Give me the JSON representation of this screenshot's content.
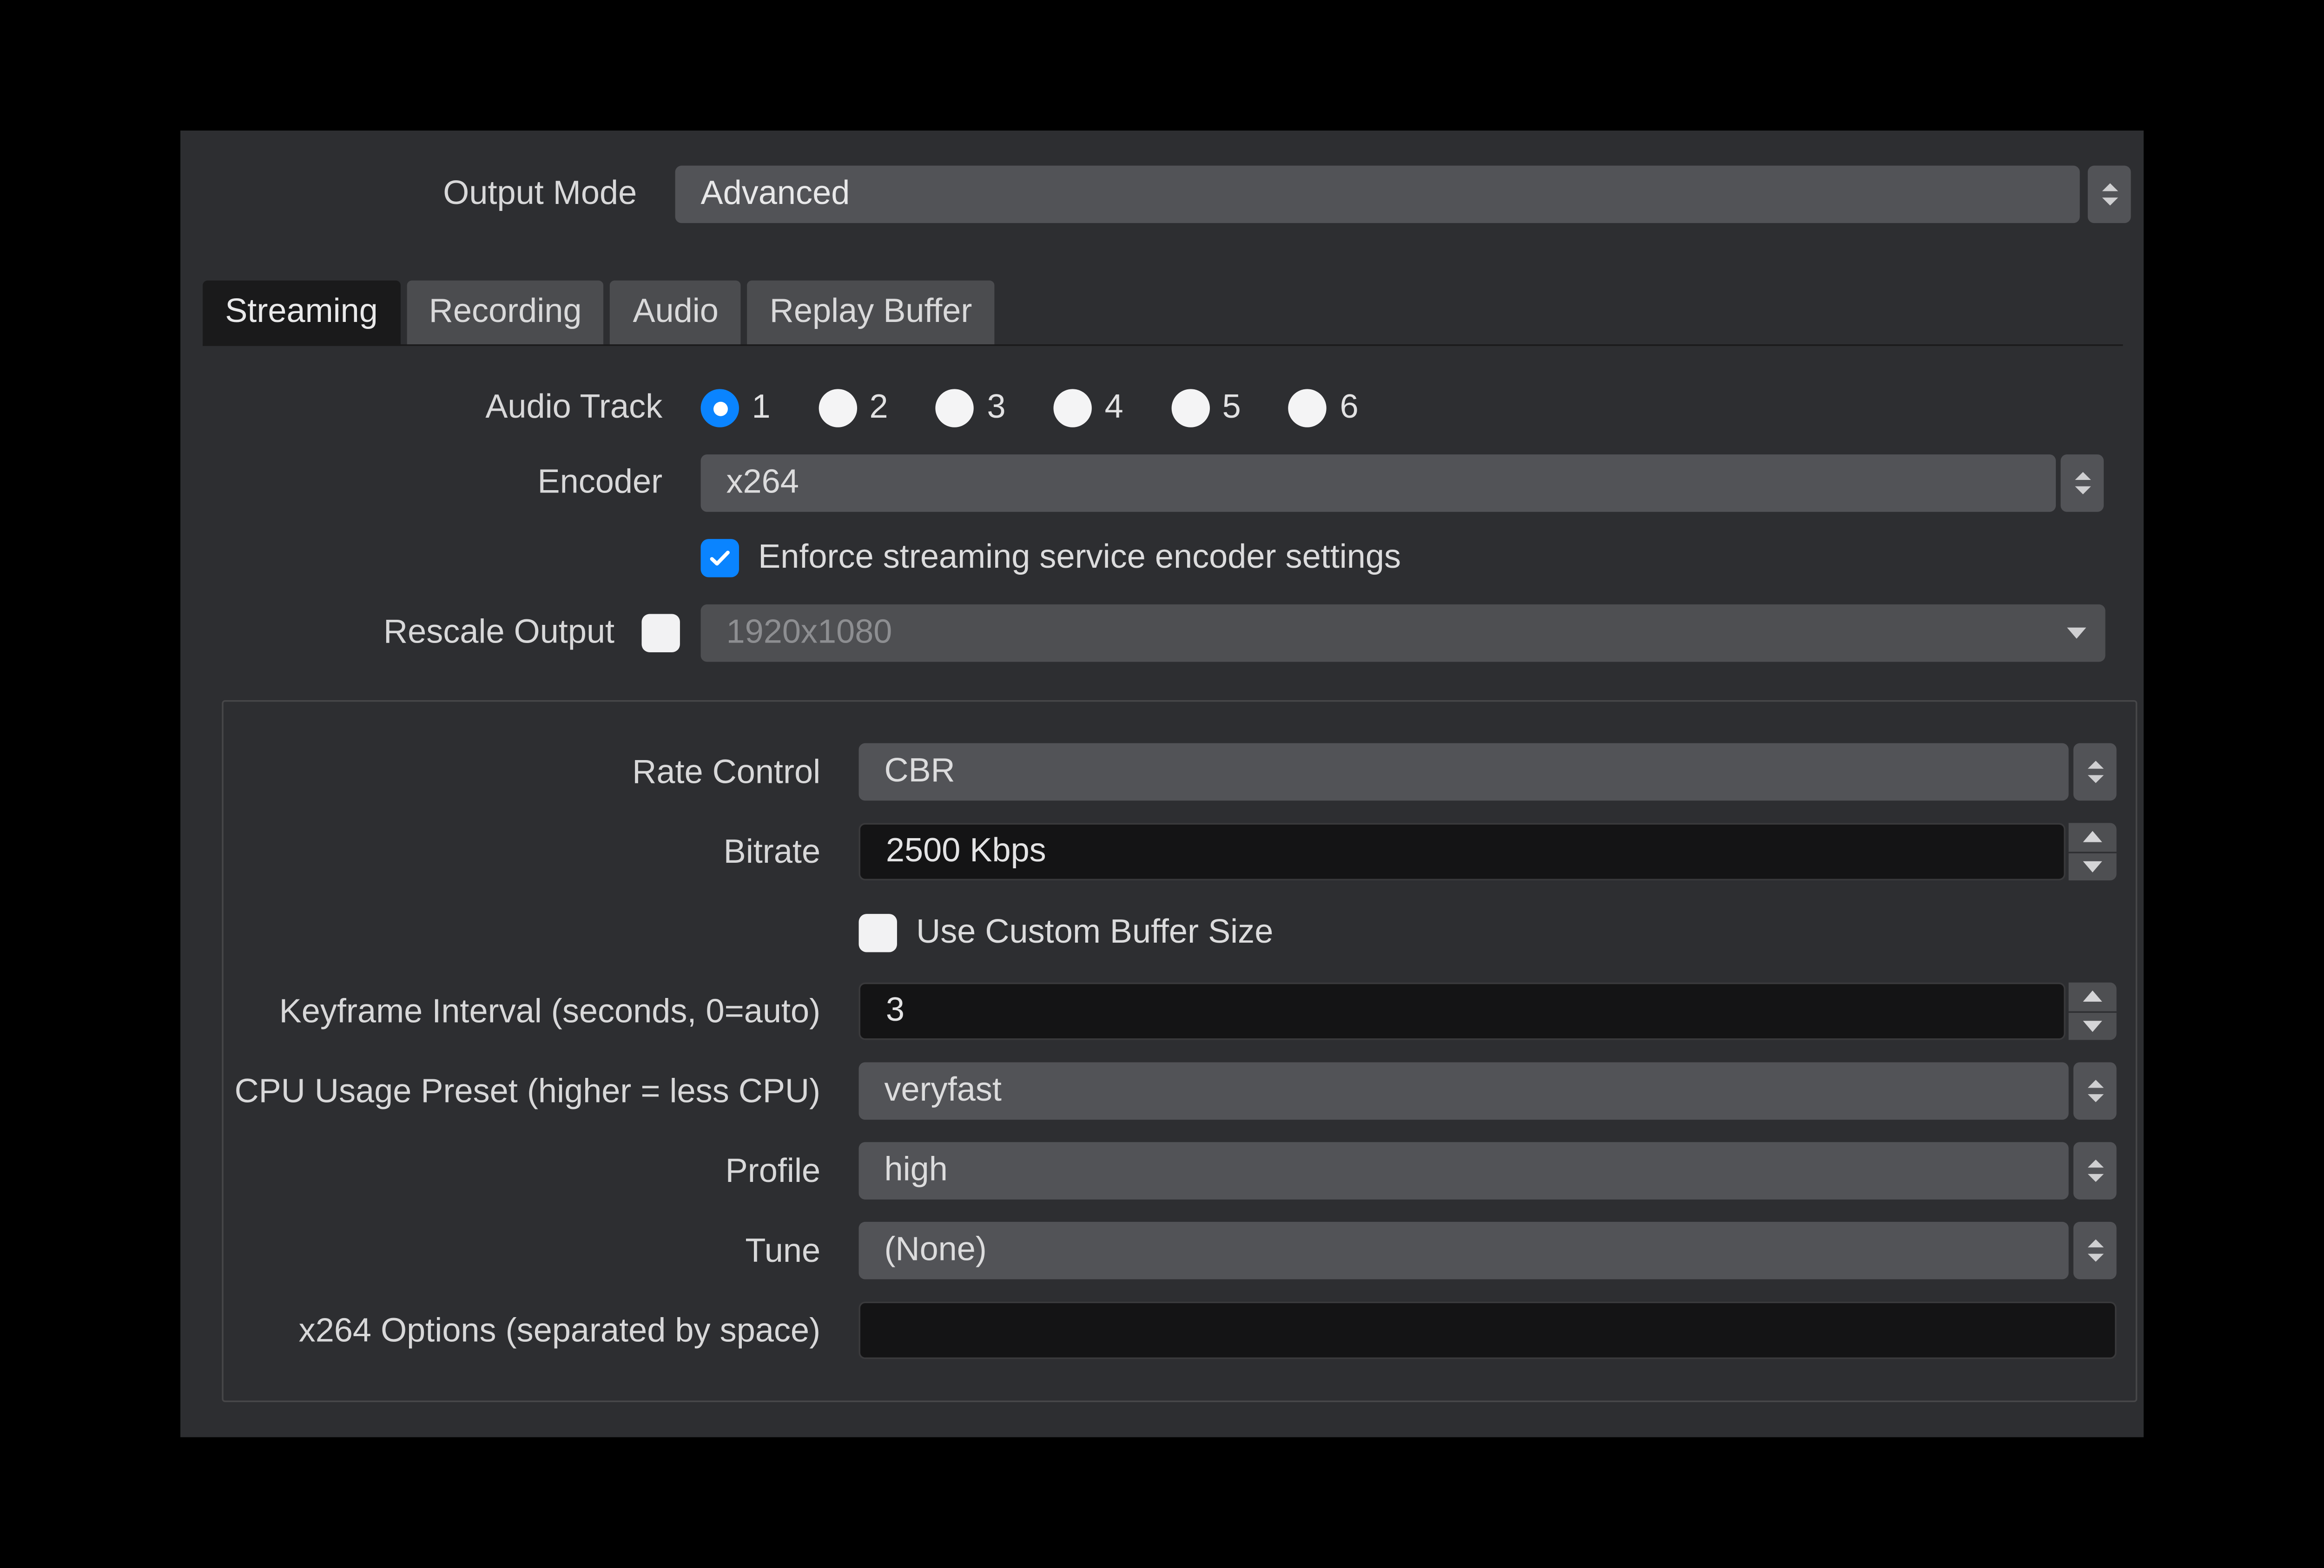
{
  "output_mode": {
    "label": "Output Mode",
    "value": "Advanced"
  },
  "tabs": {
    "streaming": "Streaming",
    "recording": "Recording",
    "audio": "Audio",
    "replay_buffer": "Replay Buffer"
  },
  "upper": {
    "audio_track_label": "Audio Track",
    "tracks": [
      "1",
      "2",
      "3",
      "4",
      "5",
      "6"
    ],
    "audio_track_selected": "1",
    "encoder_label": "Encoder",
    "encoder_value": "x264",
    "enforce_label": "Enforce streaming service encoder settings",
    "enforce_checked": true,
    "rescale_label": "Rescale Output",
    "rescale_checked": false,
    "rescale_value": "1920x1080"
  },
  "enc": {
    "rate_control_label": "Rate Control",
    "rate_control_value": "CBR",
    "bitrate_label": "Bitrate",
    "bitrate_value": "2500 Kbps",
    "custom_buffer_label": "Use Custom Buffer Size",
    "custom_buffer_checked": false,
    "keyframe_label": "Keyframe Interval (seconds, 0=auto)",
    "keyframe_value": "3",
    "cpu_preset_label": "CPU Usage Preset (higher = less CPU)",
    "cpu_preset_value": "veryfast",
    "profile_label": "Profile",
    "profile_value": "high",
    "tune_label": "Tune",
    "tune_value": "(None)",
    "x264_opts_label": "x264 Options (separated by space)",
    "x264_opts_value": ""
  }
}
